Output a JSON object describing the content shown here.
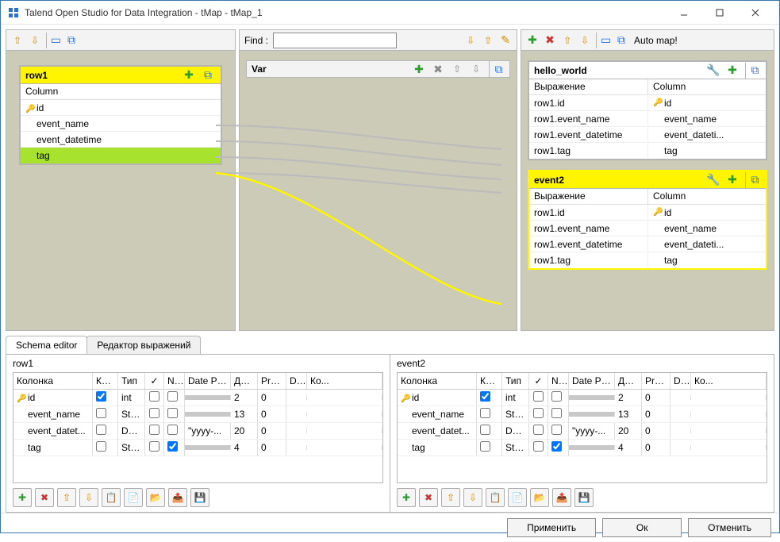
{
  "window": {
    "title": "Talend Open Studio for Data Integration - tMap - tMap_1"
  },
  "midToolbar": {
    "findLabel": "Find :",
    "findValue": ""
  },
  "rightToolbar": {
    "autoMap": "Auto map!"
  },
  "inputBox": {
    "title": "row1",
    "columnHeader": "Column",
    "rows": [
      "id",
      "event_name",
      "event_datetime",
      "tag"
    ],
    "keyRow": 0,
    "selectedRow": 3
  },
  "varBox": {
    "title": "Var"
  },
  "output1": {
    "title": "hello_world",
    "exprHeader": "Выражение",
    "colHeader": "Column",
    "rows": [
      {
        "expr": "row1.id",
        "col": "id",
        "key": true
      },
      {
        "expr": "row1.event_name",
        "col": "event_name"
      },
      {
        "expr": "row1.event_datetime",
        "col": "event_dateti..."
      },
      {
        "expr": "row1.tag",
        "col": "tag"
      }
    ]
  },
  "output2": {
    "title": "event2",
    "exprHeader": "Выражение",
    "colHeader": "Column",
    "rows": [
      {
        "expr": "row1.id",
        "col": "id",
        "key": true
      },
      {
        "expr": "row1.event_name",
        "col": "event_name"
      },
      {
        "expr": "row1.event_datetime",
        "col": "event_dateti..."
      },
      {
        "expr": "row1.tag",
        "col": "tag"
      }
    ]
  },
  "tabs": {
    "schema": "Schema editor",
    "expr": "Редактор выражений"
  },
  "schema1": {
    "title": "row1",
    "headers": {
      "col": "Колонка",
      "key": "Кл...",
      "type": "Тип",
      "chk": "✓",
      "n": "N...",
      "pat": "Date Pat...",
      "len": "Дл...",
      "pre": "Pre...",
      "d": "D...",
      "com": "Ко..."
    },
    "rows": [
      {
        "col": "id",
        "key": true,
        "type": "int",
        "chk": false,
        "n": false,
        "pat": "",
        "patGray": true,
        "len": "2",
        "pre": "0"
      },
      {
        "col": "event_name",
        "key": false,
        "type": "Stri...",
        "chk": false,
        "n": false,
        "pat": "",
        "patGray": true,
        "len": "13",
        "pre": "0"
      },
      {
        "col": "event_datet...",
        "key": false,
        "type": "Date",
        "chk": false,
        "n": false,
        "pat": "\"yyyy-...",
        "patGray": false,
        "len": "20",
        "pre": "0"
      },
      {
        "col": "tag",
        "key": false,
        "type": "Stri...",
        "chk": false,
        "n": true,
        "pat": "",
        "patGray": true,
        "len": "4",
        "pre": "0"
      }
    ]
  },
  "schema2": {
    "title": "event2",
    "headers": {
      "col": "Колонка",
      "key": "Кл...",
      "type": "Тип",
      "chk": "✓",
      "n": "N...",
      "pat": "Date Pat...",
      "len": "Дл...",
      "pre": "Pre...",
      "d": "D...",
      "com": "Ко..."
    },
    "rows": [
      {
        "col": "id",
        "key": true,
        "type": "int",
        "chk": false,
        "n": false,
        "pat": "",
        "patGray": true,
        "len": "2",
        "pre": "0"
      },
      {
        "col": "event_name",
        "key": false,
        "type": "Stri...",
        "chk": false,
        "n": false,
        "pat": "",
        "patGray": true,
        "len": "13",
        "pre": "0"
      },
      {
        "col": "event_datet...",
        "key": false,
        "type": "Date",
        "chk": false,
        "n": false,
        "pat": "\"yyyy-...",
        "patGray": false,
        "len": "20",
        "pre": "0"
      },
      {
        "col": "tag",
        "key": false,
        "type": "Stri...",
        "chk": false,
        "n": true,
        "pat": "",
        "patGray": true,
        "len": "4",
        "pre": "0"
      }
    ]
  },
  "footer": {
    "apply": "Применить",
    "ok": "Ок",
    "cancel": "Отменить"
  }
}
